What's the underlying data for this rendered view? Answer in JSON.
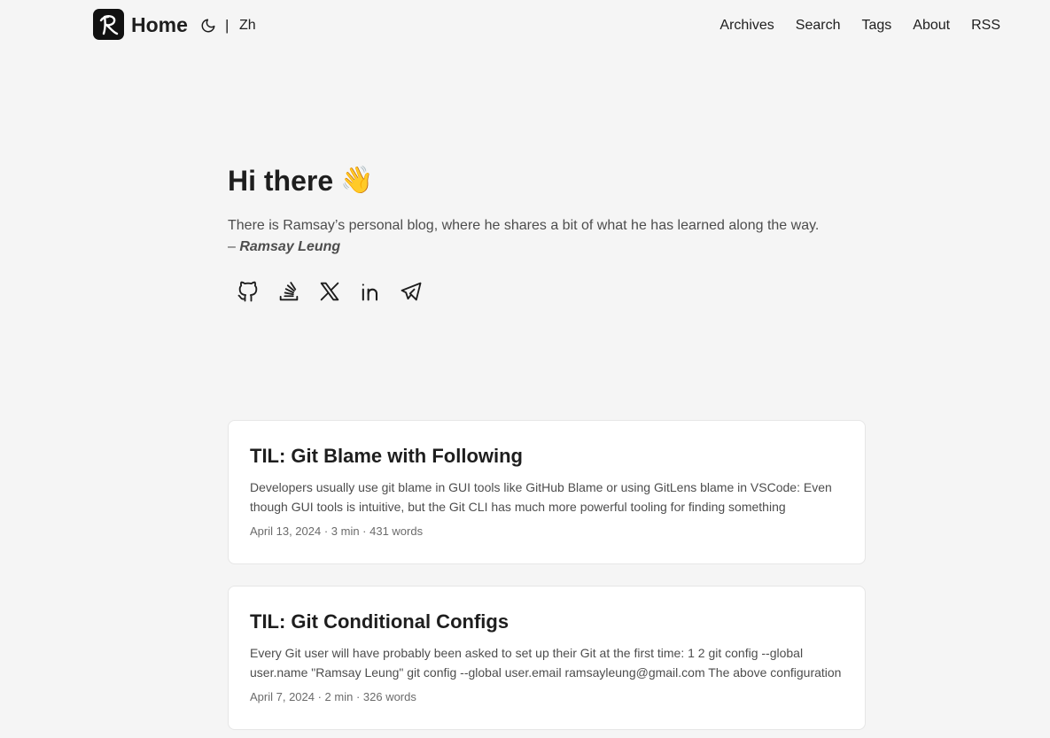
{
  "header": {
    "home_label": "Home",
    "lang_separator": "|",
    "lang_switch": "Zh",
    "nav": [
      "Archives",
      "Search",
      "Tags",
      "About",
      "RSS"
    ]
  },
  "hero": {
    "title": "Hi there",
    "emoji": "👋",
    "description": "There is Ramsay’s personal blog, where he shares a bit of what he has learned along the way.",
    "dash": "– ",
    "author": "Ramsay Leung",
    "social_icons": [
      "github-icon",
      "stackoverflow-icon",
      "x-icon",
      "linkedin-icon",
      "telegram-icon"
    ]
  },
  "posts": [
    {
      "title": "TIL: Git Blame with Following",
      "summary": "Developers usually use git blame in GUI tools like GitHub Blame or using GitLens blame in VSCode: Even though GUI tools is intuitive, but the Git CLI has much more powerful tooling for finding something",
      "meta": "April 13, 2024 · 3 min · 431 words"
    },
    {
      "title": "TIL: Git Conditional Configs",
      "summary": "Every Git user will have probably been asked to set up their Git at the first time: 1 2 git config --global user.name \"Ramsay Leung\" git config --global user.email ramsayleung@gmail.com The above configuration",
      "meta": "April 7, 2024 · 2 min · 326 words"
    }
  ],
  "colors": {
    "background": "#f5f5f5",
    "card": "#ffffff",
    "text": "#1e1e1e",
    "secondary_text": "#4d4d4d"
  }
}
